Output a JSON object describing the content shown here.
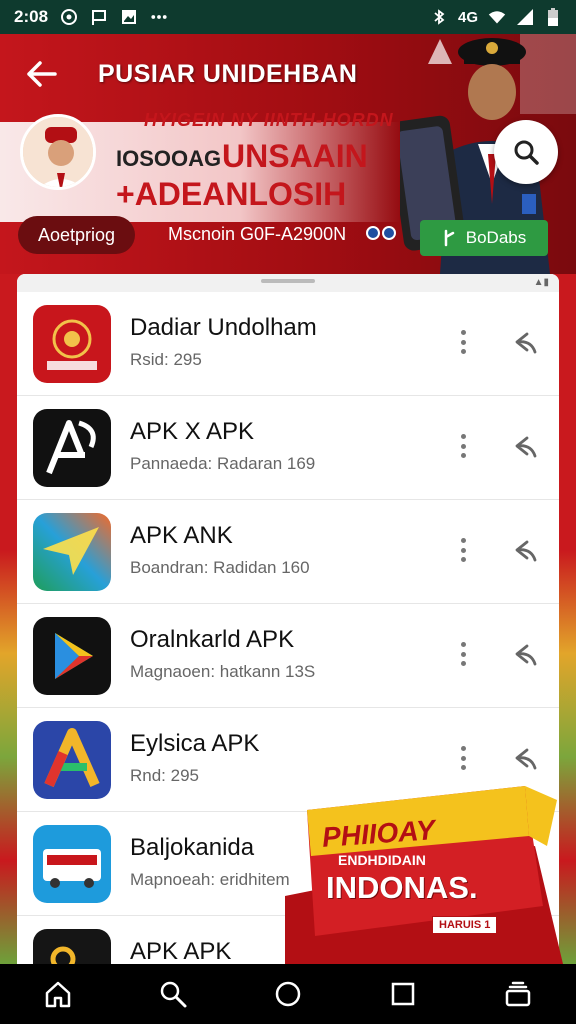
{
  "status_bar": {
    "time": "2:08",
    "signal_text": "4G",
    "icons": [
      "whatsapp-icon",
      "flag-icon",
      "image-icon",
      "more-icon",
      "bluetooth-icon",
      "wifi-icon",
      "signal-icon",
      "battery-icon"
    ]
  },
  "header": {
    "title": "PUSIAR UNIDEHBAN",
    "subtitle_line1": "HYIGEIN NY IINTH-HORDN",
    "subtitle_line2a": "IOSOOAG",
    "subtitle_line2b": "UNSAAIN",
    "subtitle_line3": "+ADEANLOSIH",
    "chip_left": "Aoetpriog",
    "chip_mid": "Mscnoin G0F-A2900N",
    "action_button": "BoDabs"
  },
  "apps": [
    {
      "name": "Dadiar Undolham",
      "sub": "Rsid: 295",
      "icon": "emblem-app-icon"
    },
    {
      "name": "APK X APK",
      "sub": "Pannaeda: Radaran 169",
      "icon": "apk-x-icon"
    },
    {
      "name": "APK ANK",
      "sub": "Boandran: Radidan 160",
      "icon": "apk-arrow-icon"
    },
    {
      "name": "Oralnkarld APK",
      "sub": "Magnaoen: hatkann 13S",
      "icon": "play-store-icon"
    },
    {
      "name": "Eylsica APK",
      "sub": "Rnd: 295",
      "icon": "a-letter-icon"
    },
    {
      "name": "Baljokanida",
      "sub": "Mapnoeah: eridhitem",
      "icon": "bus-app-icon"
    },
    {
      "name": "APK APK",
      "sub": "",
      "icon": "key-app-icon"
    }
  ],
  "promo": {
    "line1": "PHIIOAY",
    "line2": "ENDHDIDAIN",
    "line3": "INDONAS.",
    "line4": "HARUIS 1"
  },
  "colors": {
    "brand_red": "#c4161c",
    "status_bar": "#0e3a2e",
    "action_green": "#2e9a42"
  }
}
